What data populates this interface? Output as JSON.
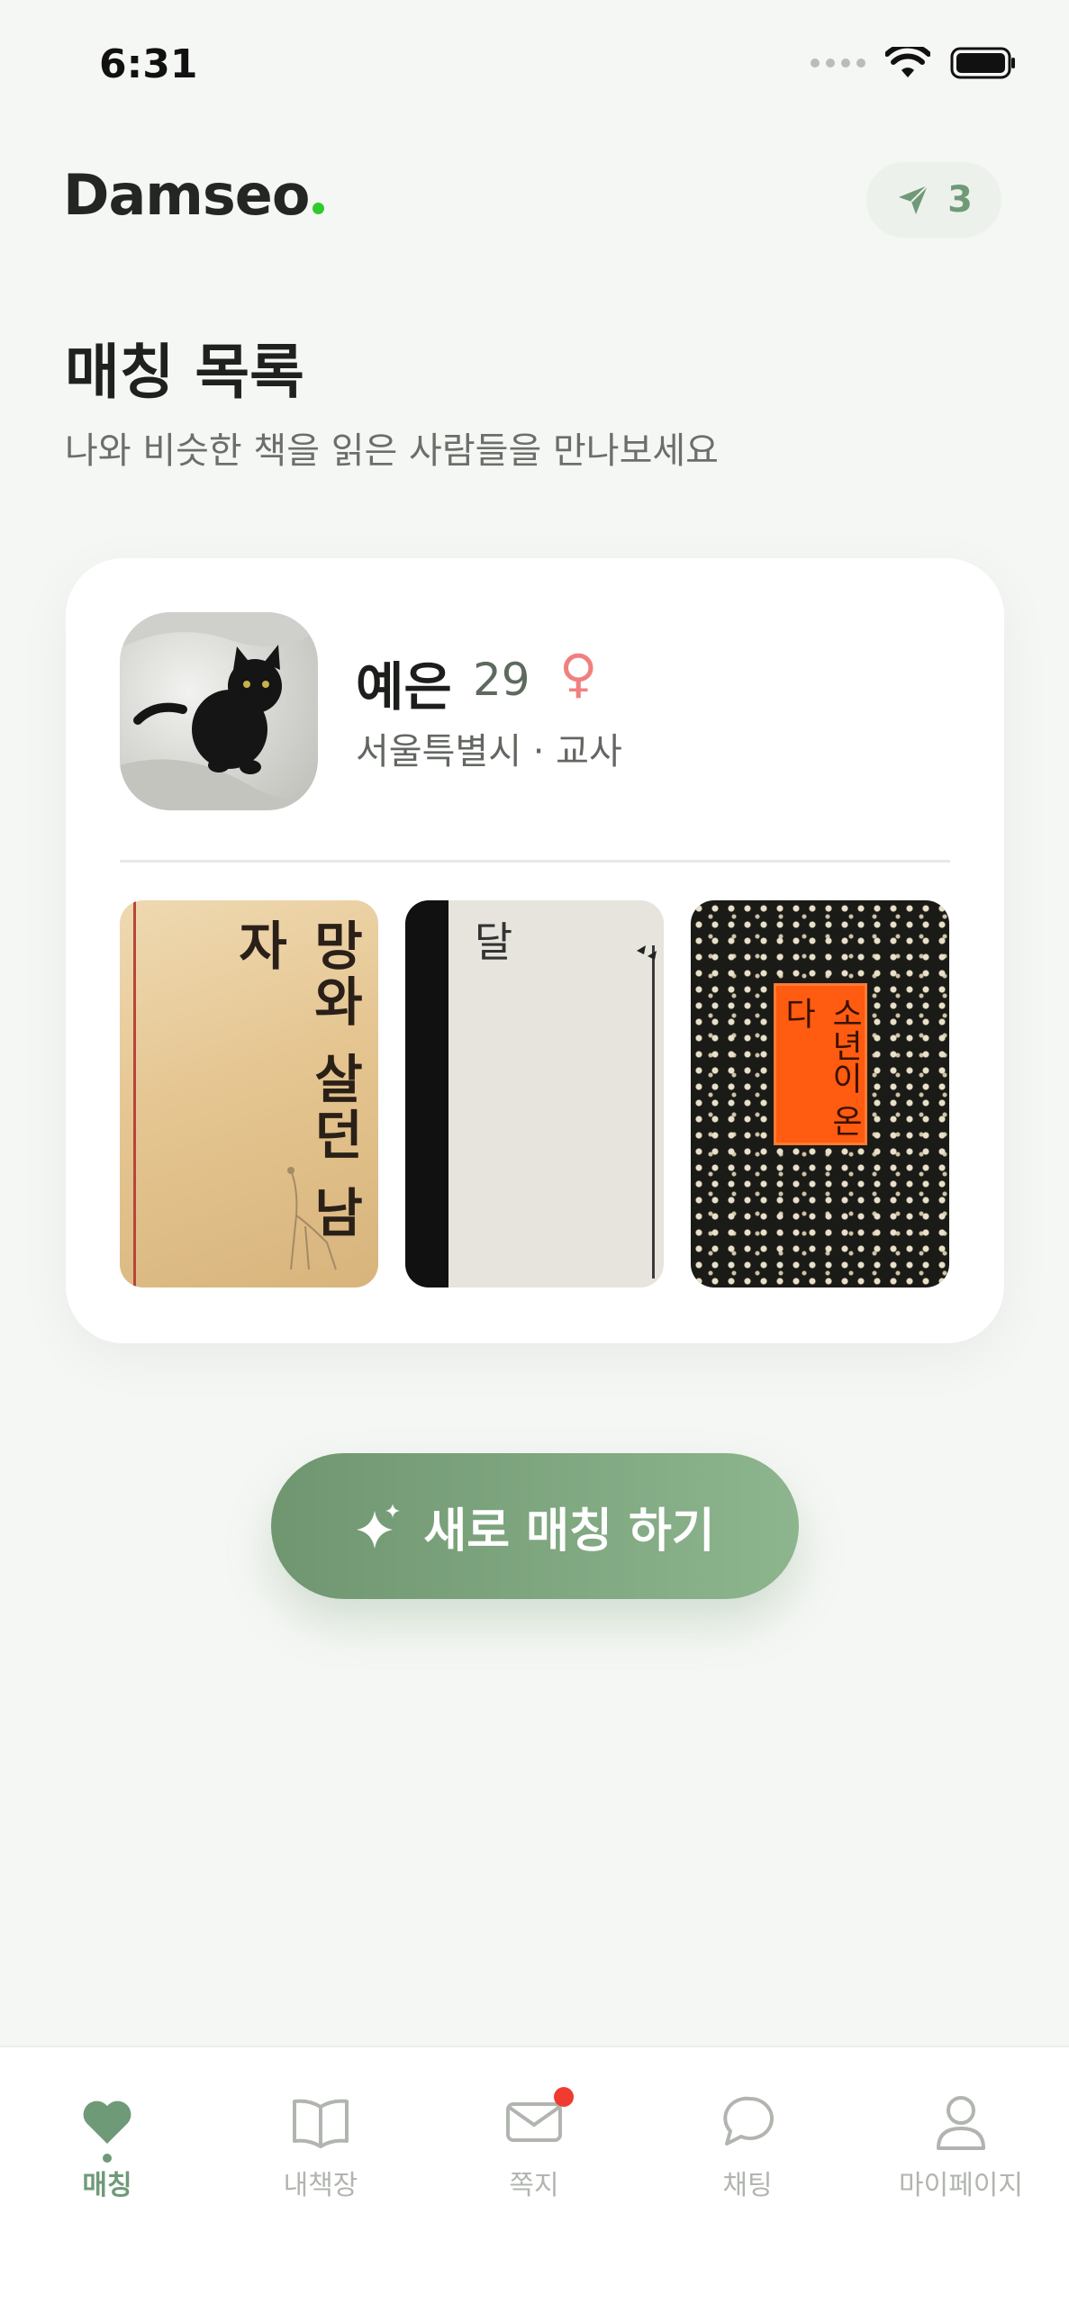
{
  "status_bar": {
    "time": "6:31"
  },
  "header": {
    "logo": "Damseo",
    "send_count": "3"
  },
  "page": {
    "title": "매칭 목록",
    "subtitle": "나와 비슷한 책을 읽은 사람들을 만나보세요"
  },
  "match_card": {
    "name": "예은",
    "age": "29",
    "gender_symbol": "♀",
    "meta": "서울특별시 · 교사",
    "books": [
      {
        "cover_title": "망와 살던 남자"
      },
      {
        "cover_title": "달"
      },
      {
        "cover_title": "소년이 온다"
      }
    ]
  },
  "cta": {
    "label": "새로 매칭 하기"
  },
  "tabbar": {
    "items": [
      {
        "label": "매칭",
        "icon": "heart-icon",
        "active": true
      },
      {
        "label": "내책장",
        "icon": "book-icon"
      },
      {
        "label": "쪽지",
        "icon": "mail-icon",
        "badge": true
      },
      {
        "label": "채팅",
        "icon": "chat-bubble-icon"
      },
      {
        "label": "마이페이지",
        "icon": "person-icon"
      }
    ]
  },
  "colors": {
    "accent": "#6f9a78",
    "cta_start": "#6f9670",
    "cta_end": "#8db58e",
    "badge": "#ef3b30",
    "gender": "#f08080"
  }
}
